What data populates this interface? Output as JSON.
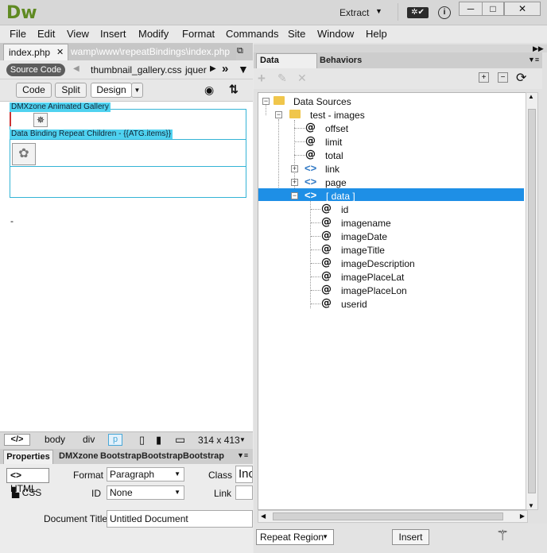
{
  "app": {
    "logo": "Dw",
    "workspace": "Extract"
  },
  "menu": [
    "File",
    "Edit",
    "View",
    "Insert",
    "Modify",
    "Format",
    "Commands",
    "Site",
    "Window",
    "Help"
  ],
  "document": {
    "active_tab": "index.php",
    "path": "wamp\\www\\repeatBindings\\index.php",
    "source_code": "Source Code",
    "related_files": [
      "thumbnail_gallery.css",
      "jquer"
    ],
    "views": {
      "code": "Code",
      "split": "Split",
      "design": "Design"
    },
    "gallery_label": "DMXzone Animated Gallery",
    "repeat_label": "Data Binding Repeat Children - {{ATG.items}}",
    "dash": "-"
  },
  "status": {
    "tag_icon": "</>",
    "crumbs": [
      "body",
      "div",
      "p"
    ],
    "dimensions": "314 x 413"
  },
  "properties": {
    "tabs": [
      "Properties",
      "DMXzone",
      "Bootstrap",
      "Bootstrap",
      "Bootstrap"
    ],
    "html": "HTML",
    "css": "CSS",
    "format_label": "Format",
    "format_value": "Paragraph",
    "class_label": "Class",
    "class_value": "Inc",
    "id_label": "ID",
    "id_value": "None",
    "link_label": "Link",
    "doc_title_label": "Document Title",
    "doc_title_value": "Untitled Document"
  },
  "panel": {
    "tabs": [
      "Data Bindings",
      "Behaviors"
    ],
    "tree": {
      "root": "Data Sources",
      "source": "test - images",
      "fields": [
        "offset",
        "limit",
        "total"
      ],
      "objects": [
        "link",
        "page"
      ],
      "selected": "[ data ]",
      "data_fields": [
        "id",
        "imagename",
        "imageDate",
        "imageTitle",
        "imageDescription",
        "imagePlaceLat",
        "imagePlaceLon",
        "userid"
      ]
    },
    "repeat_region": "Repeat Region",
    "insert": "Insert"
  }
}
